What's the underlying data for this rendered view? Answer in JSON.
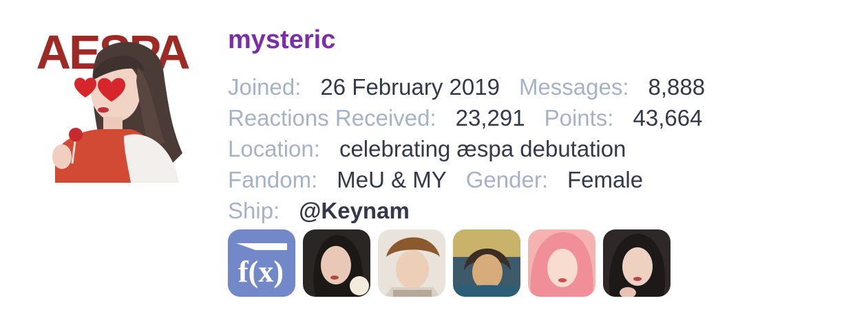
{
  "avatar": {
    "brand_text": "AESPA",
    "brand_color": "#9d2a24"
  },
  "profile": {
    "username": "mysteric",
    "username_color": "#7a2fa8",
    "rows": [
      {
        "items": [
          {
            "label": "Joined:",
            "value": "26 February 2019"
          },
          {
            "label": "Messages:",
            "value": "8,888"
          }
        ]
      },
      {
        "items": [
          {
            "label": "Reactions Received:",
            "value": "23,291"
          },
          {
            "label": "Points:",
            "value": "43,664"
          }
        ]
      },
      {
        "items": [
          {
            "label": "Location:",
            "value": "celebrating æspa debutation"
          }
        ]
      },
      {
        "items": [
          {
            "label": "Fandom:",
            "value": "MeU & MY"
          },
          {
            "label": "Gender:",
            "value": "Female"
          }
        ]
      },
      {
        "items": [
          {
            "label": "Ship:",
            "value": "@Keynam"
          }
        ]
      }
    ]
  },
  "ships": [
    {
      "name": "fx-logo",
      "logo_text": "f(x)",
      "bg": "#7388c8"
    },
    {
      "name": "member-1",
      "bg": "#2a2624"
    },
    {
      "name": "member-2",
      "bg": "#e9e3dc"
    },
    {
      "name": "member-3",
      "bg": "#3c5a6a"
    },
    {
      "name": "member-4",
      "bg": "#f4b3b0"
    },
    {
      "name": "member-5",
      "bg": "#2e2928"
    }
  ]
}
